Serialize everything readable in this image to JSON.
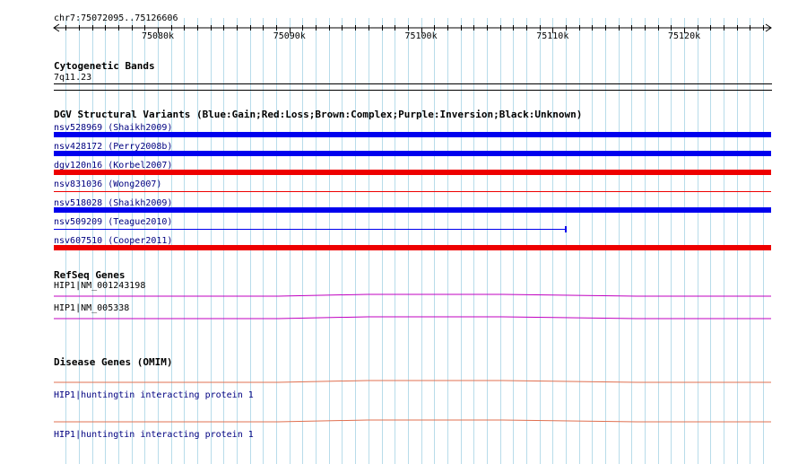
{
  "ruler": {
    "position": "chr7:75072095..75126606",
    "start": 75072095,
    "end": 75126606,
    "major_ticks": [
      {
        "pos": 75080000,
        "label": "75080k"
      },
      {
        "pos": 75090000,
        "label": "75090k"
      },
      {
        "pos": 75100000,
        "label": "75100k"
      },
      {
        "pos": 75110000,
        "label": "75110k"
      },
      {
        "pos": 75120000,
        "label": "75120k"
      }
    ]
  },
  "cytoband": {
    "title": "Cytogenetic Bands",
    "band": "7q11.23"
  },
  "dgv": {
    "title": "DGV Structural Variants (Blue:Gain;Red:Loss;Brown:Complex;Purple:Inversion;Black:Unknown)",
    "variants": [
      {
        "name": "nsv528969 (Shaikh2009)",
        "color": "#0000ee",
        "style": "thick",
        "end": 75126606
      },
      {
        "name": "nsv428172 (Perry2008b)",
        "color": "#0000ee",
        "style": "thick",
        "end": 75126606
      },
      {
        "name": "dgv120n16 (Korbel2007)",
        "color": "#ee0000",
        "style": "thick",
        "end": 75126606
      },
      {
        "name": "nsv831036 (Wong2007)",
        "color": "#ee0000",
        "style": "thin",
        "end": 75126606
      },
      {
        "name": "nsv518028 (Shaikh2009)",
        "color": "#0000ee",
        "style": "thick",
        "end": 75126606
      },
      {
        "name": "nsv509209 (Teague2010)",
        "color": "#0000ee",
        "style": "thin",
        "end": 75111000
      },
      {
        "name": "nsv607510 (Cooper2011)",
        "color": "#ee0000",
        "style": "thick",
        "end": 75126606
      }
    ]
  },
  "refseq": {
    "title": "RefSeq Genes",
    "color": "#c000c0",
    "genes": [
      {
        "name": "HIP1|NM_001243198"
      },
      {
        "name": "HIP1|NM_005338"
      }
    ]
  },
  "omim": {
    "title": "Disease Genes (OMIM)",
    "color": "#e07050",
    "genes": [
      {
        "name": "HIP1|huntingtin interacting protein 1"
      },
      {
        "name": "HIP1|huntingtin interacting protein 1"
      }
    ]
  }
}
